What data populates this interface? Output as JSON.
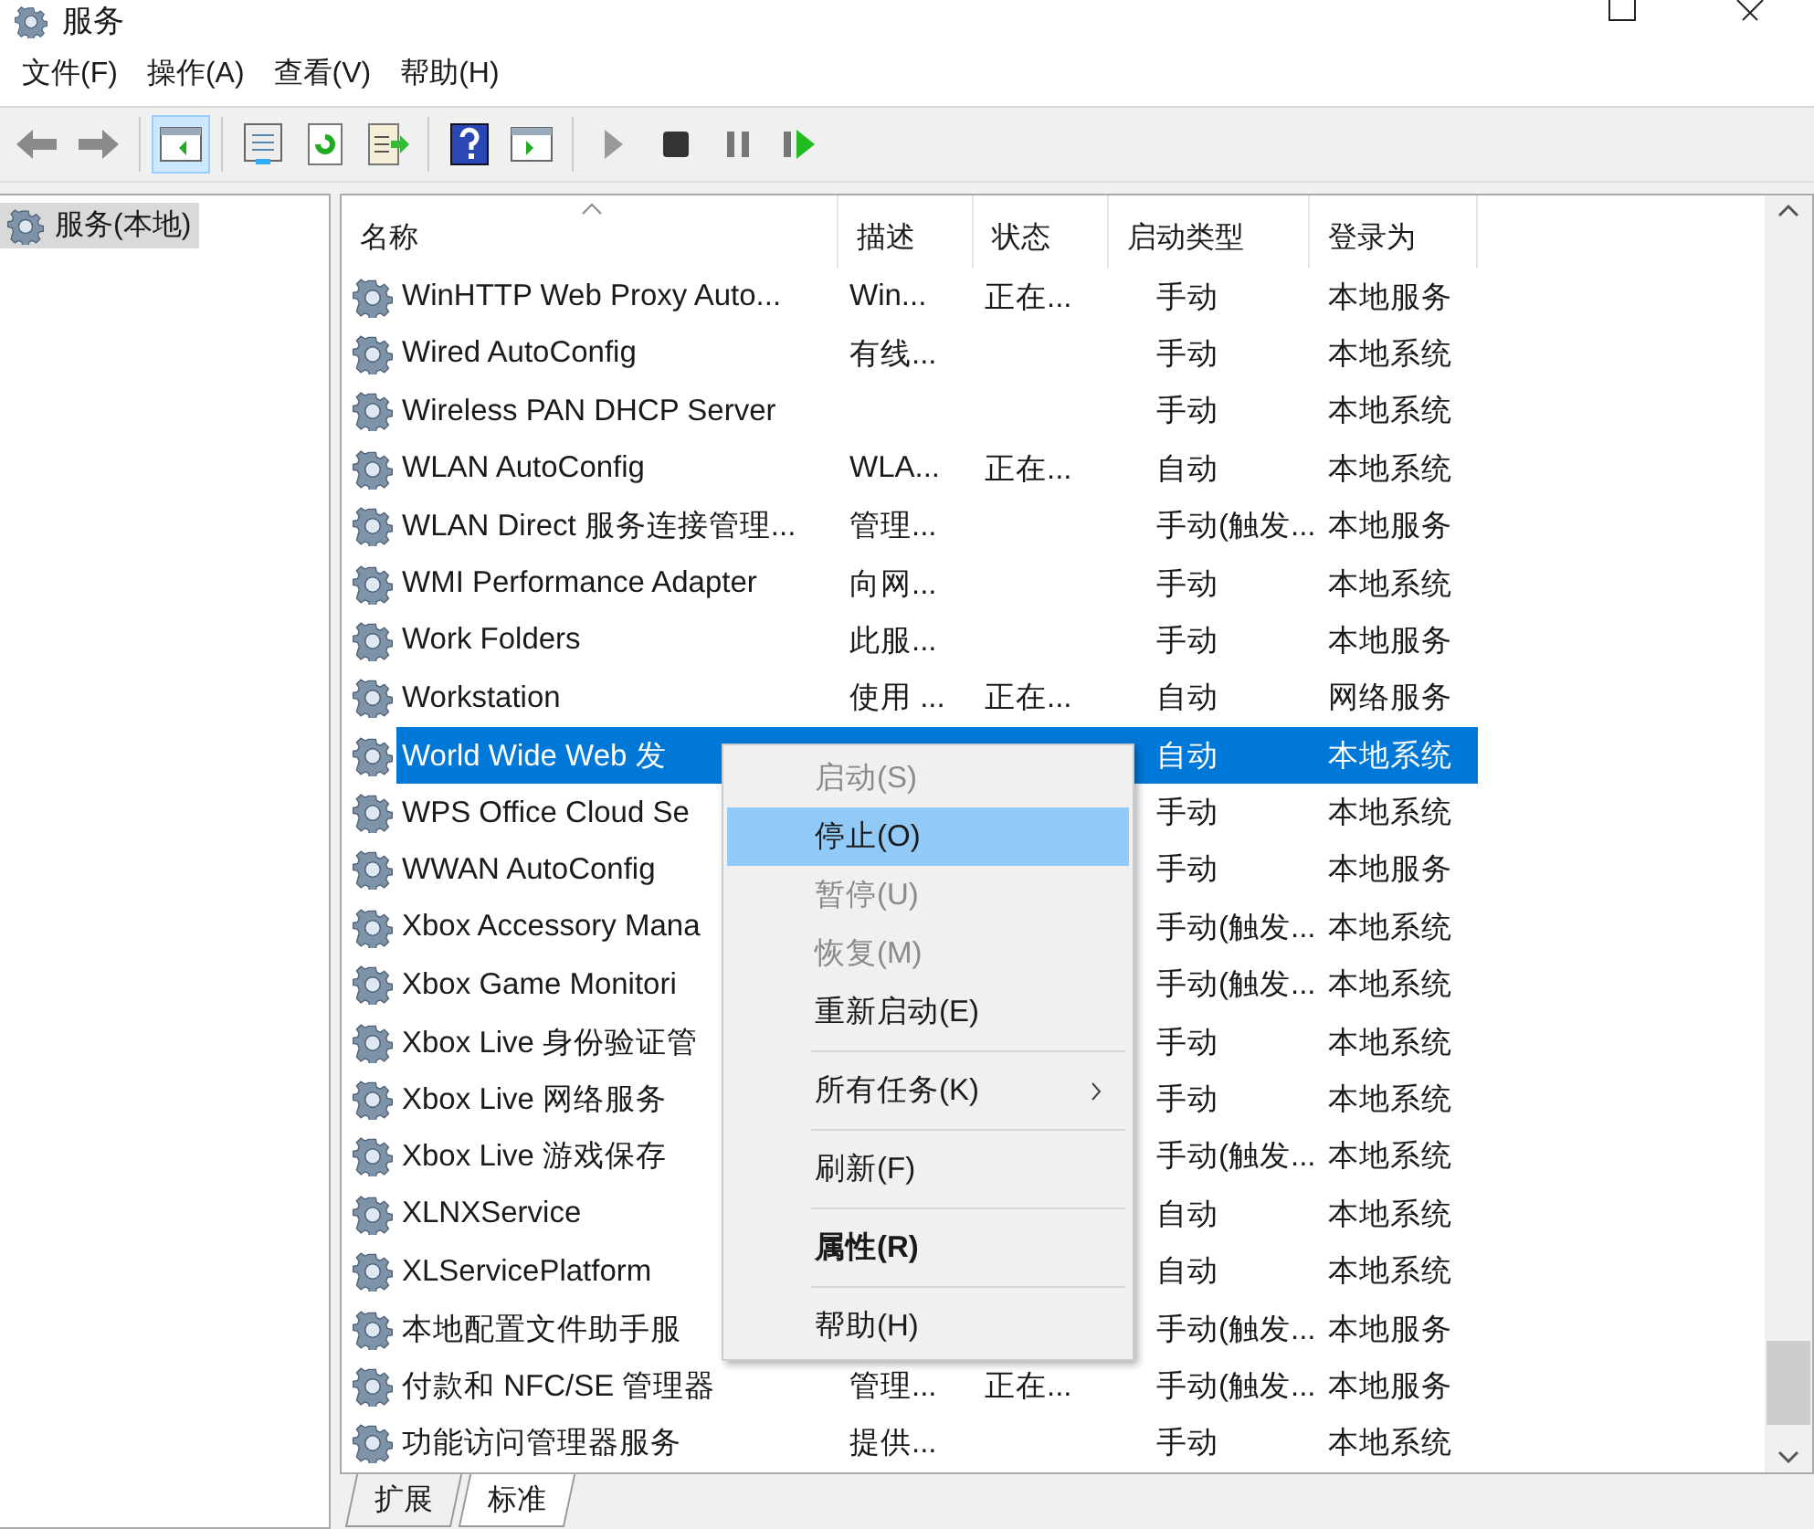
{
  "window": {
    "title": "服务"
  },
  "menu_bar": [
    "文件(F)",
    "操作(A)",
    "查看(V)",
    "帮助(H)"
  ],
  "toolbar": [
    {
      "kind": "back",
      "selected": false
    },
    {
      "kind": "forward",
      "selected": false
    },
    {
      "kind": "pane-left",
      "selected": true,
      "separator_before": true
    },
    {
      "kind": "properties",
      "selected": false,
      "separator_before": true
    },
    {
      "kind": "refresh",
      "selected": false
    },
    {
      "kind": "export",
      "selected": false
    },
    {
      "kind": "help",
      "selected": false,
      "separator_before": true
    },
    {
      "kind": "pane-right",
      "selected": false
    },
    {
      "kind": "play",
      "selected": false,
      "separator_before": true
    },
    {
      "kind": "stop",
      "selected": false
    },
    {
      "kind": "pause",
      "selected": false
    },
    {
      "kind": "resume",
      "selected": false
    }
  ],
  "tree": [
    {
      "label": "服务(本地)",
      "selected": true
    }
  ],
  "table": {
    "columns": [
      "名称",
      "描述",
      "状态",
      "启动类型",
      "登录为"
    ],
    "rows": [
      {
        "name": "WinHTTP Web Proxy Auto...",
        "description": "Win...",
        "status": "正在...",
        "startup": "手动",
        "logon": "本地服务",
        "selected": false
      },
      {
        "name": "Wired AutoConfig",
        "description": "有线...",
        "startup": "手动",
        "logon": "本地系统",
        "selected": false
      },
      {
        "name": "Wireless PAN DHCP Server",
        "startup": "手动",
        "logon": "本地系统",
        "selected": false
      },
      {
        "name": "WLAN AutoConfig",
        "description": "WLA...",
        "status": "正在...",
        "startup": "自动",
        "logon": "本地系统",
        "selected": false
      },
      {
        "name": "WLAN Direct 服务连接管理...",
        "description": "管理...",
        "startup": "手动(触发...",
        "logon": "本地服务",
        "selected": false
      },
      {
        "name": "WMI Performance Adapter",
        "description": "向网...",
        "startup": "手动",
        "logon": "本地系统",
        "selected": false
      },
      {
        "name": "Work Folders",
        "description": "此服...",
        "startup": "手动",
        "logon": "本地服务",
        "selected": false
      },
      {
        "name": "Workstation",
        "description": "使用 ...",
        "status": "正在...",
        "startup": "自动",
        "logon": "网络服务",
        "selected": false
      },
      {
        "name": "World Wide Web 发",
        "startup": "自动",
        "logon": "本地系统",
        "selected": true
      },
      {
        "name": "WPS Office Cloud Se",
        "startup": "手动",
        "logon": "本地系统",
        "selected": false
      },
      {
        "name": "WWAN AutoConfig",
        "startup": "手动",
        "logon": "本地服务",
        "selected": false
      },
      {
        "name": "Xbox Accessory Mana",
        "startup": "手动(触发...",
        "logon": "本地系统",
        "selected": false
      },
      {
        "name": "Xbox Game Monitori",
        "startup": "手动(触发...",
        "logon": "本地系统",
        "selected": false
      },
      {
        "name": "Xbox Live 身份验证管",
        "startup": "手动",
        "logon": "本地系统",
        "selected": false
      },
      {
        "name": "Xbox Live 网络服务",
        "startup": "手动",
        "logon": "本地系统",
        "selected": false
      },
      {
        "name": "Xbox Live 游戏保存",
        "startup": "手动(触发...",
        "logon": "本地系统",
        "selected": false
      },
      {
        "name": "XLNXService",
        "startup": "自动",
        "logon": "本地系统",
        "selected": false
      },
      {
        "name": "XLServicePlatform",
        "startup": "自动",
        "logon": "本地系统",
        "selected": false
      },
      {
        "name": "本地配置文件助手服",
        "startup": "手动(触发...",
        "logon": "本地服务",
        "selected": false
      },
      {
        "name": "付款和 NFC/SE 管理器",
        "description": "管理...",
        "status": "正在...",
        "startup": "手动(触发...",
        "logon": "本地服务",
        "selected": false
      },
      {
        "name": "功能访问管理器服务",
        "description": "提供...",
        "startup": "手动",
        "logon": "本地系统",
        "selected": false
      }
    ]
  },
  "context_menu": [
    {
      "kind": "item",
      "label": "启动(S)",
      "disabled": true,
      "selected": false
    },
    {
      "kind": "item",
      "label": "停止(O)",
      "disabled": false,
      "selected": true
    },
    {
      "kind": "item",
      "label": "暂停(U)",
      "disabled": true,
      "selected": false
    },
    {
      "kind": "item",
      "label": "恢复(M)",
      "disabled": true,
      "selected": false
    },
    {
      "kind": "item",
      "label": "重新启动(E)",
      "disabled": false,
      "selected": false
    },
    {
      "kind": "separator"
    },
    {
      "kind": "submenu",
      "label": "所有任务(K)",
      "disabled": false,
      "selected": false
    },
    {
      "kind": "separator"
    },
    {
      "kind": "item",
      "label": "刷新(F)",
      "disabled": false,
      "selected": false
    },
    {
      "kind": "separator"
    },
    {
      "kind": "default",
      "label": "属性(R)",
      "disabled": false,
      "selected": false
    },
    {
      "kind": "separator"
    },
    {
      "kind": "item",
      "label": "帮助(H)",
      "disabled": false,
      "selected": false
    }
  ],
  "bottom_tabs": [
    {
      "label": "扩展",
      "selected": false
    },
    {
      "label": "标准",
      "selected": true
    }
  ]
}
